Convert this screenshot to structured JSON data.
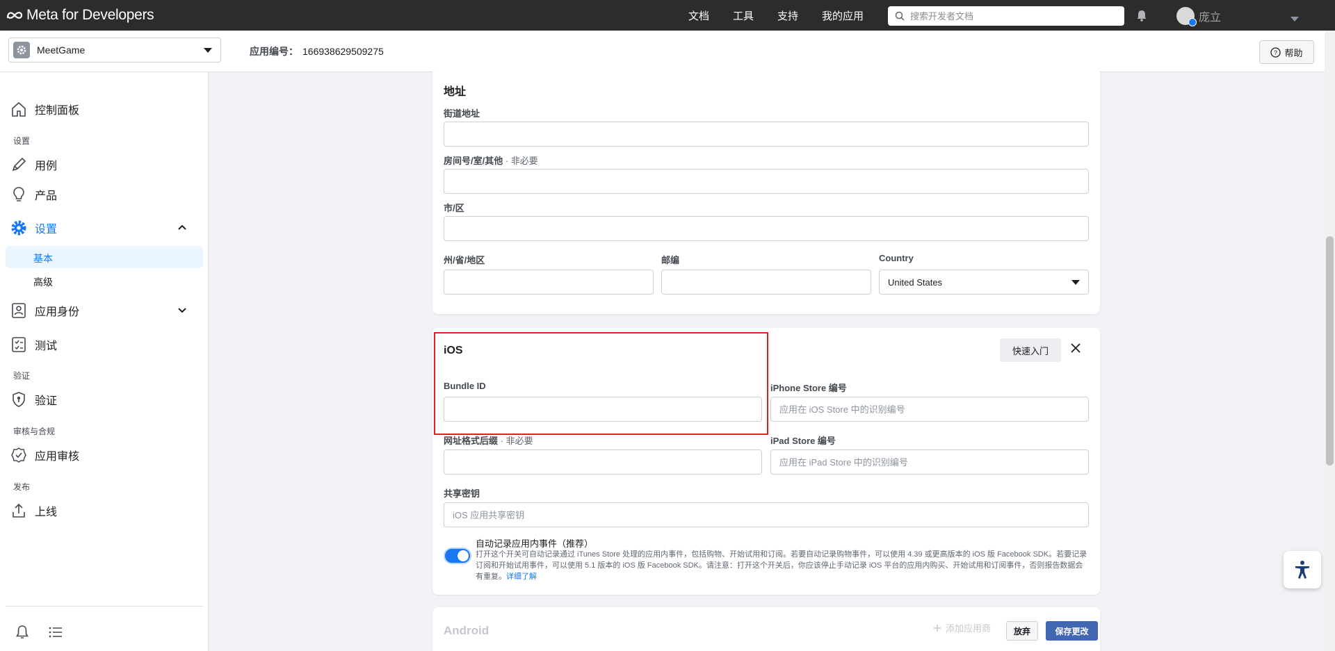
{
  "topbar": {
    "logo_text": "Meta for Developers",
    "nav": [
      "文档",
      "工具",
      "支持",
      "我的应用"
    ],
    "search_placeholder": "搜索开发者文档",
    "user_name": "庞立"
  },
  "subbar": {
    "app_name": "MeetGame",
    "app_id_label": "应用编号：",
    "app_id": "166938629509275",
    "help_label": "帮助"
  },
  "sidebar": {
    "dashboard": "控制面板",
    "section_settings": "设置",
    "use_cases": "用例",
    "products": "产品",
    "settings": "设置",
    "basic": "基本",
    "advanced": "高级",
    "app_roles": "应用身份",
    "testing": "测试",
    "section_verification": "验证",
    "verification": "验证",
    "section_review": "审核与合规",
    "app_review": "应用审核",
    "section_publish": "发布",
    "go_live": "上线"
  },
  "address": {
    "title": "地址",
    "street_label": "街道地址",
    "unit_label": "房间号/室/其他",
    "unit_optional": " · 非必要",
    "city_label": "市/区",
    "state_label": "州/省/地区",
    "zip_label": "邮编",
    "country_label": "Country",
    "country_value": "United States"
  },
  "ios": {
    "title": "iOS",
    "quick_start": "快速入门",
    "bundle_id_label": "Bundle ID",
    "iphone_label": "iPhone Store 编号",
    "iphone_placeholder": "应用在 iOS Store 中的识别编号",
    "url_suffix_label": "网址格式后缀",
    "url_suffix_optional": " · 非必要",
    "ipad_label": "iPad Store 编号",
    "ipad_placeholder": "应用在 iPad Store 中的识别编号",
    "shared_secret_label": "共享密钥",
    "shared_secret_placeholder": "iOS 应用共享密钥",
    "toggle_title": "自动记录应用内事件（推荐）",
    "toggle_desc": "打开这个开关可自动记录通过 iTunes Store 处理的应用内事件，包括购物、开始试用和订阅。若要自动记录购物事件，可以使用 4.39 或更高版本的 iOS 版 Facebook SDK。若要记录订阅和开始试用事件，可以使用 5.1 版本的 iOS 版 Facebook SDK。请注意：打开这个开关后，你应该停止手动记录 iOS 平台的应用内购买、开始试用和订阅事件，否则报告数据会有重复。",
    "learn_more": "详细了解"
  },
  "android": {
    "title": "Android",
    "add_label": "添加应用商"
  },
  "footer": {
    "discard": "放弃",
    "save": "保存更改"
  },
  "colors": {
    "accent": "#1877f2",
    "highlight": "#e41e1e",
    "save": "#4267b2"
  }
}
